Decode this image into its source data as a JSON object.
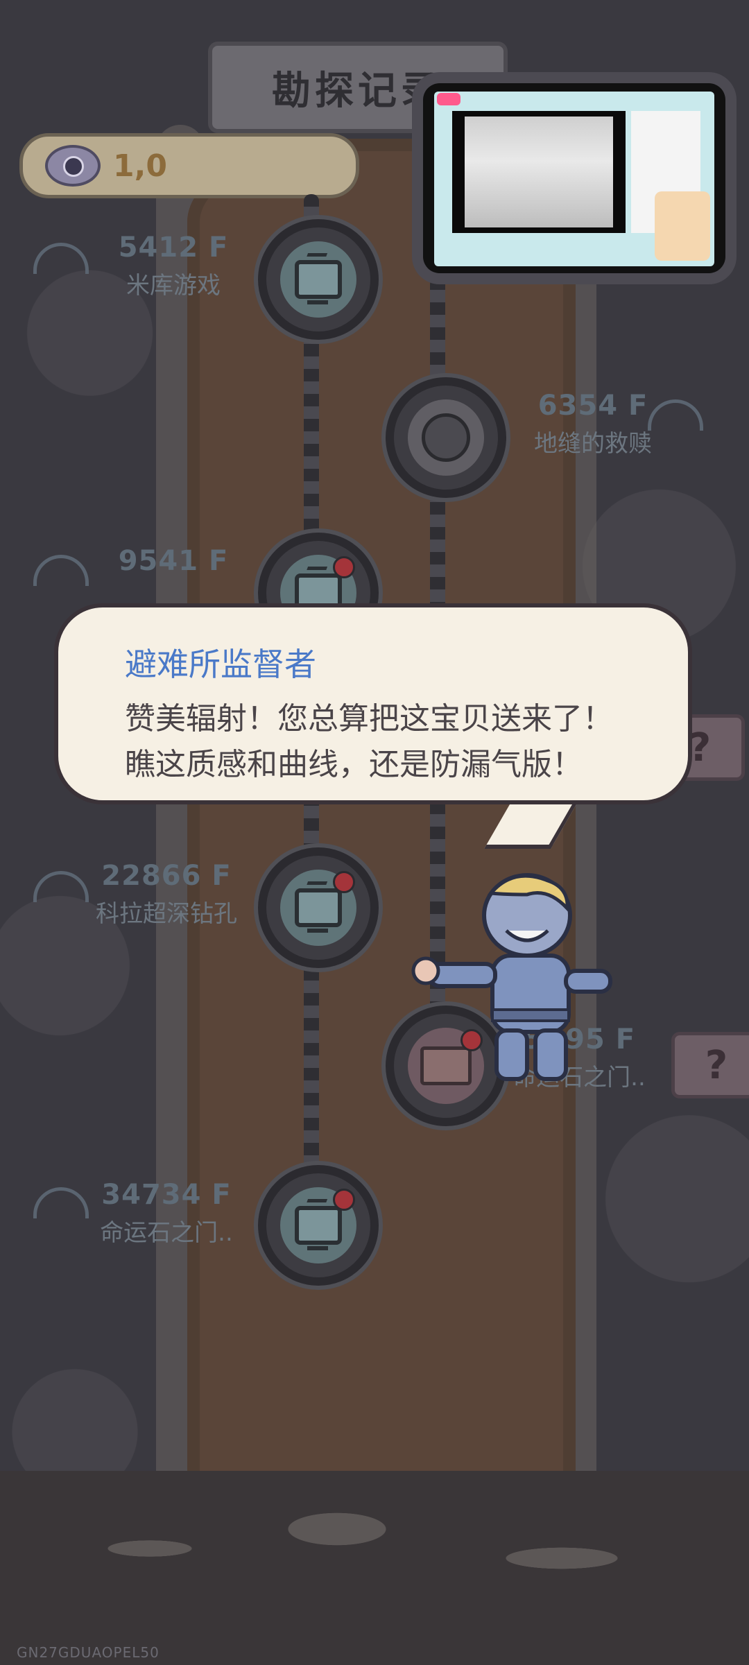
{
  "header": {
    "title": "勘探记录",
    "eye_count": "1,0"
  },
  "nodes": [
    {
      "depth": "5412 F",
      "name": "米库游戏",
      "icon": "tv-icon",
      "alert": false
    },
    {
      "depth": "6354 F",
      "name": "地缝的救赎",
      "icon": "face-icon",
      "alert": false
    },
    {
      "depth": "9541 F",
      "name": "",
      "icon": "tv-icon",
      "alert": true
    },
    {
      "depth": "22866 F",
      "name": "科拉超深钻孔",
      "icon": "tv-icon",
      "alert": true
    },
    {
      "depth": "5..95 F",
      "name": "命运石之门..",
      "icon": "map-icon",
      "alert": true
    },
    {
      "depth": "34734 F",
      "name": "命运石之门..",
      "icon": "tv-icon",
      "alert": true
    }
  ],
  "question_buttons": [
    "?",
    "?"
  ],
  "dialog": {
    "speaker": "避难所监督者",
    "line1": "赞美辐射！您总算把这宝贝送来了！",
    "line2": "瞧这质感和曲线，还是防漏气版！"
  },
  "watermark": "GN27GDUAOPEL50",
  "colors": {
    "background": "#3b3a40",
    "shaft": "#5a4539",
    "bubble": "#f6f0e4",
    "speaker_name": "#4a79c8",
    "alert_dot": "#a4343a"
  }
}
